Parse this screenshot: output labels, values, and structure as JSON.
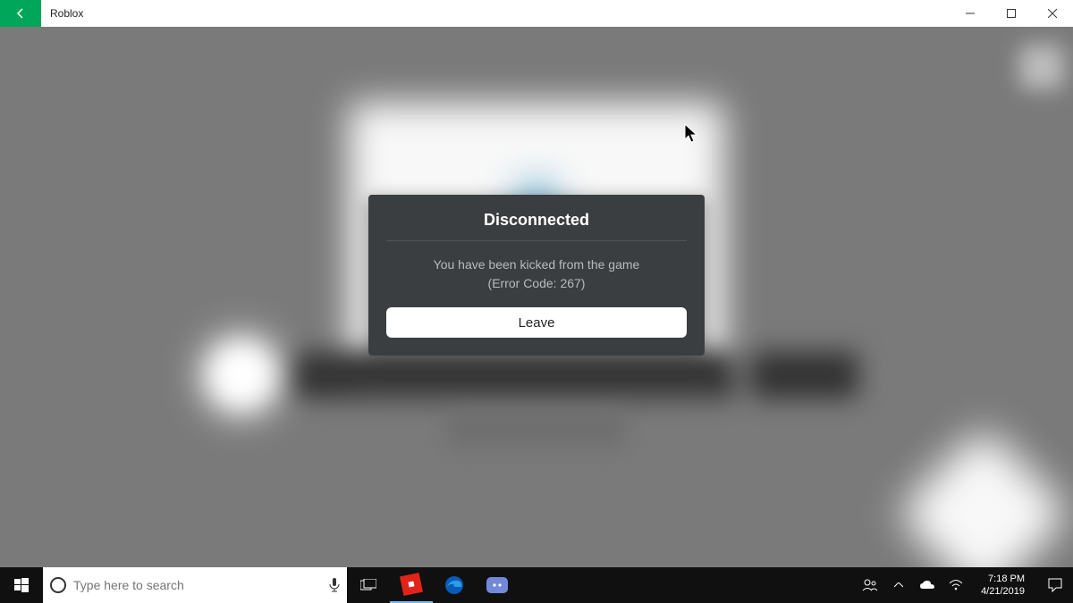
{
  "window": {
    "title": "Roblox"
  },
  "modal": {
    "title": "Disconnected",
    "message_line1": "You have been kicked from the game",
    "message_line2": "(Error Code: 267)",
    "leave_label": "Leave"
  },
  "taskbar": {
    "search_placeholder": "Type here to search",
    "time": "7:18 PM",
    "date": "4/21/2019"
  }
}
